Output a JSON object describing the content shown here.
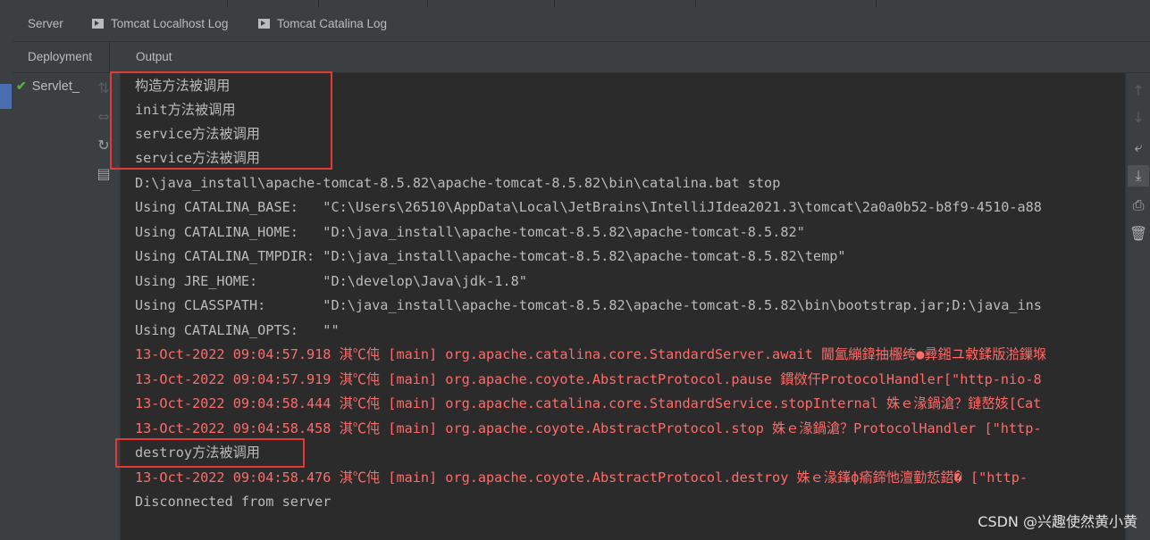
{
  "tabs": [
    {
      "label": "Server",
      "icon": null
    },
    {
      "label": "Tomcat Localhost Log",
      "icon": "console-log-icon"
    },
    {
      "label": "Tomcat Catalina Log",
      "icon": "console-log-icon"
    }
  ],
  "subtabs": {
    "deployment": "Deployment",
    "output": "Output"
  },
  "deployment": {
    "item": "Servlet_",
    "status_icon": "check-icon",
    "status_color": "#5ca84b"
  },
  "toolbar_icons": [
    "move-up-icon",
    "move-down-icon",
    "soft-wrap-icon",
    "scroll-to-end-icon",
    "print-icon",
    "clear-all-icon"
  ],
  "deploy_icons": [
    "deploy-all-icon",
    "redeploy-icon",
    "refresh-icon",
    "deploy-artifact-icon"
  ],
  "output_lines": [
    {
      "text": "构造方法被调用",
      "level": "info"
    },
    {
      "text": "init方法被调用",
      "level": "info"
    },
    {
      "text": "service方法被调用",
      "level": "info"
    },
    {
      "text": "service方法被调用",
      "level": "info"
    },
    {
      "text": "D:\\java_install\\apache-tomcat-8.5.82\\apache-tomcat-8.5.82\\bin\\catalina.bat stop",
      "level": "info"
    },
    {
      "text": "Using CATALINA_BASE:   \"C:\\Users\\26510\\AppData\\Local\\JetBrains\\IntelliJIdea2021.3\\tomcat\\2a0a0b52-b8f9-4510-a88",
      "level": "info"
    },
    {
      "text": "Using CATALINA_HOME:   \"D:\\java_install\\apache-tomcat-8.5.82\\apache-tomcat-8.5.82\"",
      "level": "info"
    },
    {
      "text": "Using CATALINA_TMPDIR: \"D:\\java_install\\apache-tomcat-8.5.82\\apache-tomcat-8.5.82\\temp\"",
      "level": "info"
    },
    {
      "text": "Using JRE_HOME:        \"D:\\develop\\Java\\jdk-1.8\"",
      "level": "info"
    },
    {
      "text": "Using CLASSPATH:       \"D:\\java_install\\apache-tomcat-8.5.82\\apache-tomcat-8.5.82\\bin\\bootstrap.jar;D:\\java_ins",
      "level": "info"
    },
    {
      "text": "Using CATALINA_OPTS:   \"\"",
      "level": "info"
    },
    {
      "text": "13-Oct-2022 09:04:57.918 淇℃伅 [main] org.apache.catalina.core.StandardServer.await 閫氳繃鍏抽棴绔●彛鎺ユ敹鍒版湁鏁堢",
      "level": "error"
    },
    {
      "text": "13-Oct-2022 09:04:57.919 淇℃伅 [main] org.apache.coyote.AbstractProtocol.pause 鏆傚仠ProtocolHandler[\"http-nio-8",
      "level": "error"
    },
    {
      "text": "13-Oct-2022 09:04:58.444 淇℃伅 [main] org.apache.catalina.core.StandardService.stopInternal 姝ｅ湪鍋滄？鏈嶅姟[Cat",
      "level": "error"
    },
    {
      "text": "13-Oct-2022 09:04:58.458 淇℃伅 [main] org.apache.coyote.AbstractProtocol.stop 姝ｅ湪鍋滄？ProtocolHandler [\"http-",
      "level": "error"
    },
    {
      "text": "destroy方法被调用",
      "level": "info"
    },
    {
      "text": "13-Oct-2022 09:04:58.476 淇℃伅 [main] org.apache.coyote.AbstractProtocol.destroy 姝ｅ湪鎽ф瘉鍗忚澶勭悊鍣� [\"http-",
      "level": "error"
    },
    {
      "text": "Disconnected from server",
      "level": "info"
    }
  ],
  "watermark": "CSDN @兴趣使然黄小黄",
  "colors": {
    "background": "#2b2b2b",
    "panel": "#3c3f41",
    "text": "#bbbbbb",
    "error": "#ff6b68",
    "highlight_box": "#e53935"
  }
}
